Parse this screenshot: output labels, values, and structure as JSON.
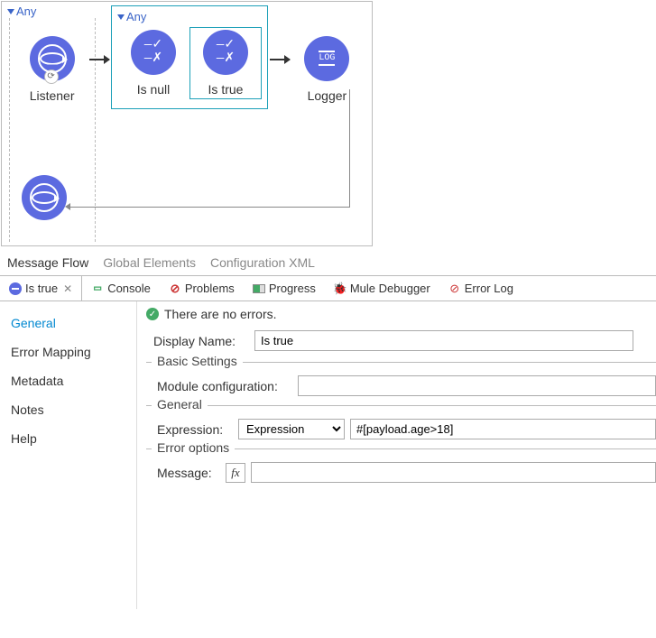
{
  "canvas": {
    "outerScope": "Any",
    "innerScope": "Any",
    "nodes": {
      "listener": "Listener",
      "isnull": "Is null",
      "istrue": "Is true",
      "logger": "Logger"
    }
  },
  "editorTabs": {
    "messageFlow": "Message Flow",
    "globalElements": "Global Elements",
    "configXml": "Configuration XML"
  },
  "panelTabs": {
    "istrue": "Is true",
    "console": "Console",
    "problems": "Problems",
    "progress": "Progress",
    "debugger": "Mule Debugger",
    "errorLog": "Error Log"
  },
  "sideNav": {
    "general": "General",
    "errorMapping": "Error Mapping",
    "metadata": "Metadata",
    "notes": "Notes",
    "help": "Help"
  },
  "props": {
    "statusText": "There are no errors.",
    "displayNameLabel": "Display Name:",
    "displayNameValue": "Is true",
    "basicSettingsLegend": "Basic Settings",
    "moduleConfigLabel": "Module configuration:",
    "moduleConfigValue": "",
    "generalLegend": "General",
    "expressionLabel": "Expression:",
    "expressionMode": "Expression",
    "expressionValue": "#[payload.age>18]",
    "errorOptionsLegend": "Error options",
    "messageLabel": "Message:",
    "messageValue": ""
  }
}
